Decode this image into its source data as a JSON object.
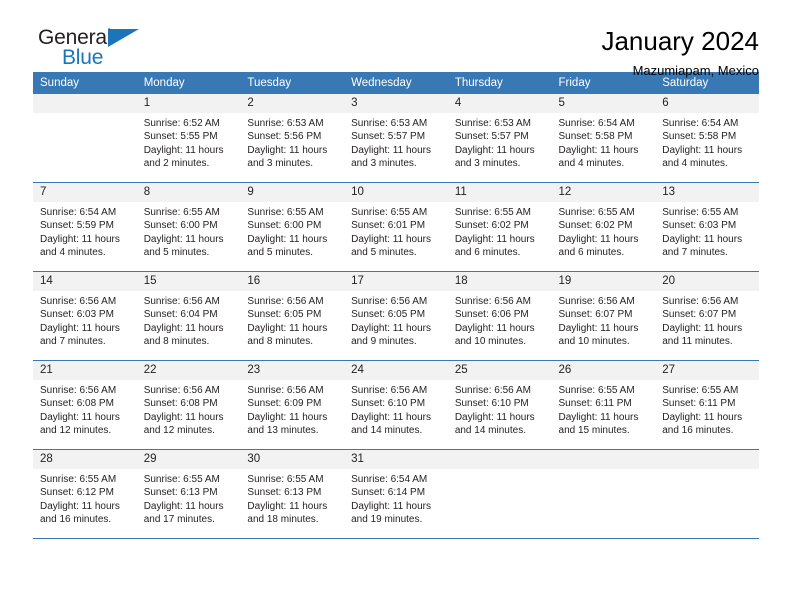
{
  "brand": {
    "name_part1": "General",
    "name_part2": "Blue",
    "triangle_color": "#1b75bb"
  },
  "header": {
    "title": "January 2024",
    "location": "Mazumiapam, Mexico",
    "accent_color": "#3878b4"
  },
  "weekday_headers": [
    "Sunday",
    "Monday",
    "Tuesday",
    "Wednesday",
    "Thursday",
    "Friday",
    "Saturday"
  ],
  "weeks": [
    [
      {
        "day": "",
        "sunrise": "",
        "sunset": "",
        "daylight1": "",
        "daylight2": ""
      },
      {
        "day": "1",
        "sunrise": "Sunrise: 6:52 AM",
        "sunset": "Sunset: 5:55 PM",
        "daylight1": "Daylight: 11 hours",
        "daylight2": "and 2 minutes."
      },
      {
        "day": "2",
        "sunrise": "Sunrise: 6:53 AM",
        "sunset": "Sunset: 5:56 PM",
        "daylight1": "Daylight: 11 hours",
        "daylight2": "and 3 minutes."
      },
      {
        "day": "3",
        "sunrise": "Sunrise: 6:53 AM",
        "sunset": "Sunset: 5:57 PM",
        "daylight1": "Daylight: 11 hours",
        "daylight2": "and 3 minutes."
      },
      {
        "day": "4",
        "sunrise": "Sunrise: 6:53 AM",
        "sunset": "Sunset: 5:57 PM",
        "daylight1": "Daylight: 11 hours",
        "daylight2": "and 3 minutes."
      },
      {
        "day": "5",
        "sunrise": "Sunrise: 6:54 AM",
        "sunset": "Sunset: 5:58 PM",
        "daylight1": "Daylight: 11 hours",
        "daylight2": "and 4 minutes."
      },
      {
        "day": "6",
        "sunrise": "Sunrise: 6:54 AM",
        "sunset": "Sunset: 5:58 PM",
        "daylight1": "Daylight: 11 hours",
        "daylight2": "and 4 minutes."
      }
    ],
    [
      {
        "day": "7",
        "sunrise": "Sunrise: 6:54 AM",
        "sunset": "Sunset: 5:59 PM",
        "daylight1": "Daylight: 11 hours",
        "daylight2": "and 4 minutes."
      },
      {
        "day": "8",
        "sunrise": "Sunrise: 6:55 AM",
        "sunset": "Sunset: 6:00 PM",
        "daylight1": "Daylight: 11 hours",
        "daylight2": "and 5 minutes."
      },
      {
        "day": "9",
        "sunrise": "Sunrise: 6:55 AM",
        "sunset": "Sunset: 6:00 PM",
        "daylight1": "Daylight: 11 hours",
        "daylight2": "and 5 minutes."
      },
      {
        "day": "10",
        "sunrise": "Sunrise: 6:55 AM",
        "sunset": "Sunset: 6:01 PM",
        "daylight1": "Daylight: 11 hours",
        "daylight2": "and 5 minutes."
      },
      {
        "day": "11",
        "sunrise": "Sunrise: 6:55 AM",
        "sunset": "Sunset: 6:02 PM",
        "daylight1": "Daylight: 11 hours",
        "daylight2": "and 6 minutes."
      },
      {
        "day": "12",
        "sunrise": "Sunrise: 6:55 AM",
        "sunset": "Sunset: 6:02 PM",
        "daylight1": "Daylight: 11 hours",
        "daylight2": "and 6 minutes."
      },
      {
        "day": "13",
        "sunrise": "Sunrise: 6:55 AM",
        "sunset": "Sunset: 6:03 PM",
        "daylight1": "Daylight: 11 hours",
        "daylight2": "and 7 minutes."
      }
    ],
    [
      {
        "day": "14",
        "sunrise": "Sunrise: 6:56 AM",
        "sunset": "Sunset: 6:03 PM",
        "daylight1": "Daylight: 11 hours",
        "daylight2": "and 7 minutes."
      },
      {
        "day": "15",
        "sunrise": "Sunrise: 6:56 AM",
        "sunset": "Sunset: 6:04 PM",
        "daylight1": "Daylight: 11 hours",
        "daylight2": "and 8 minutes."
      },
      {
        "day": "16",
        "sunrise": "Sunrise: 6:56 AM",
        "sunset": "Sunset: 6:05 PM",
        "daylight1": "Daylight: 11 hours",
        "daylight2": "and 8 minutes."
      },
      {
        "day": "17",
        "sunrise": "Sunrise: 6:56 AM",
        "sunset": "Sunset: 6:05 PM",
        "daylight1": "Daylight: 11 hours",
        "daylight2": "and 9 minutes."
      },
      {
        "day": "18",
        "sunrise": "Sunrise: 6:56 AM",
        "sunset": "Sunset: 6:06 PM",
        "daylight1": "Daylight: 11 hours",
        "daylight2": "and 10 minutes."
      },
      {
        "day": "19",
        "sunrise": "Sunrise: 6:56 AM",
        "sunset": "Sunset: 6:07 PM",
        "daylight1": "Daylight: 11 hours",
        "daylight2": "and 10 minutes."
      },
      {
        "day": "20",
        "sunrise": "Sunrise: 6:56 AM",
        "sunset": "Sunset: 6:07 PM",
        "daylight1": "Daylight: 11 hours",
        "daylight2": "and 11 minutes."
      }
    ],
    [
      {
        "day": "21",
        "sunrise": "Sunrise: 6:56 AM",
        "sunset": "Sunset: 6:08 PM",
        "daylight1": "Daylight: 11 hours",
        "daylight2": "and 12 minutes."
      },
      {
        "day": "22",
        "sunrise": "Sunrise: 6:56 AM",
        "sunset": "Sunset: 6:08 PM",
        "daylight1": "Daylight: 11 hours",
        "daylight2": "and 12 minutes."
      },
      {
        "day": "23",
        "sunrise": "Sunrise: 6:56 AM",
        "sunset": "Sunset: 6:09 PM",
        "daylight1": "Daylight: 11 hours",
        "daylight2": "and 13 minutes."
      },
      {
        "day": "24",
        "sunrise": "Sunrise: 6:56 AM",
        "sunset": "Sunset: 6:10 PM",
        "daylight1": "Daylight: 11 hours",
        "daylight2": "and 14 minutes."
      },
      {
        "day": "25",
        "sunrise": "Sunrise: 6:56 AM",
        "sunset": "Sunset: 6:10 PM",
        "daylight1": "Daylight: 11 hours",
        "daylight2": "and 14 minutes."
      },
      {
        "day": "26",
        "sunrise": "Sunrise: 6:55 AM",
        "sunset": "Sunset: 6:11 PM",
        "daylight1": "Daylight: 11 hours",
        "daylight2": "and 15 minutes."
      },
      {
        "day": "27",
        "sunrise": "Sunrise: 6:55 AM",
        "sunset": "Sunset: 6:11 PM",
        "daylight1": "Daylight: 11 hours",
        "daylight2": "and 16 minutes."
      }
    ],
    [
      {
        "day": "28",
        "sunrise": "Sunrise: 6:55 AM",
        "sunset": "Sunset: 6:12 PM",
        "daylight1": "Daylight: 11 hours",
        "daylight2": "and 16 minutes."
      },
      {
        "day": "29",
        "sunrise": "Sunrise: 6:55 AM",
        "sunset": "Sunset: 6:13 PM",
        "daylight1": "Daylight: 11 hours",
        "daylight2": "and 17 minutes."
      },
      {
        "day": "30",
        "sunrise": "Sunrise: 6:55 AM",
        "sunset": "Sunset: 6:13 PM",
        "daylight1": "Daylight: 11 hours",
        "daylight2": "and 18 minutes."
      },
      {
        "day": "31",
        "sunrise": "Sunrise: 6:54 AM",
        "sunset": "Sunset: 6:14 PM",
        "daylight1": "Daylight: 11 hours",
        "daylight2": "and 19 minutes."
      },
      {
        "day": "",
        "sunrise": "",
        "sunset": "",
        "daylight1": "",
        "daylight2": ""
      },
      {
        "day": "",
        "sunrise": "",
        "sunset": "",
        "daylight1": "",
        "daylight2": ""
      },
      {
        "day": "",
        "sunrise": "",
        "sunset": "",
        "daylight1": "",
        "daylight2": ""
      }
    ]
  ]
}
